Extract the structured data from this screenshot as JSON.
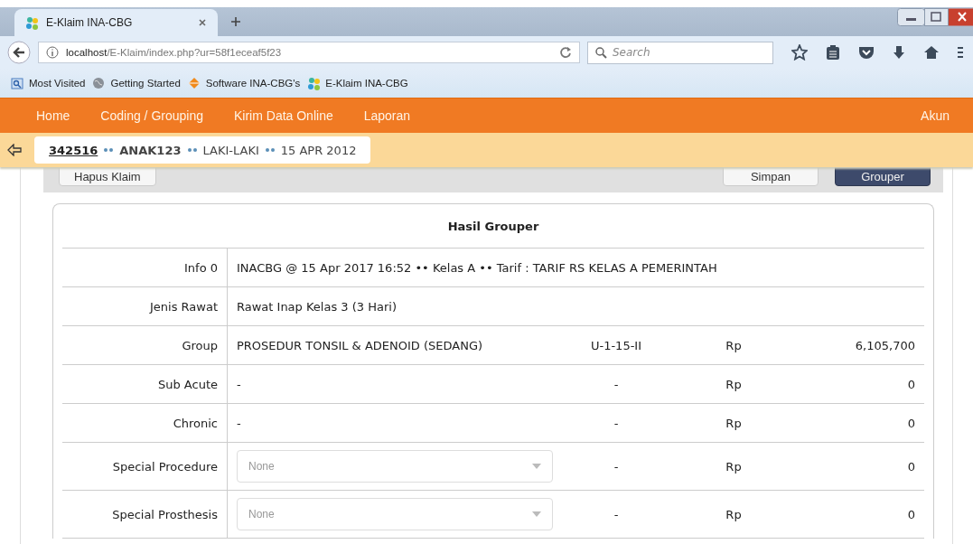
{
  "browser": {
    "tab": {
      "title": "E-Klaim INA-CBG",
      "selected": true
    },
    "url": {
      "host": "localhost",
      "path": "/E-Klaim/index.php?ur=58f1eceaf5f23"
    },
    "search": {
      "placeholder": "Search"
    },
    "bookmarks": [
      {
        "label": "Most Visited",
        "kind": "folder"
      },
      {
        "label": "Getting Started",
        "kind": "globe"
      },
      {
        "label": "Software INA-CBG's",
        "kind": "diamond"
      },
      {
        "label": "E-Klaim INA-CBG",
        "kind": "app"
      }
    ]
  },
  "nav": {
    "items": [
      "Home",
      "Coding / Grouping",
      "Kirim Data Online",
      "Laporan"
    ],
    "account": "Akun"
  },
  "patient": {
    "id": "342516",
    "name": "ANAK123",
    "sex": "LAKI-LAKI",
    "birth": "15 APR 2012"
  },
  "toolbar": {
    "left": [
      "Hapus Klaim"
    ],
    "right": [
      {
        "label": "Simpan",
        "primary": false
      },
      {
        "label": "Grouper",
        "primary": true
      }
    ]
  },
  "result": {
    "title": "Hasil Grouper",
    "rows": [
      {
        "label": "Info 0",
        "kind": "text",
        "value": "INACBG @ 15 Apr 2017 16:52 •• Kelas A •• Tarif : TARIF RS KELAS A PEMERINTAH"
      },
      {
        "label": "Jenis Rawat",
        "kind": "text",
        "value": "Rawat Inap Kelas 3 (3 Hari)"
      },
      {
        "label": "Group",
        "kind": "tariff",
        "value": "PROSEDUR TONSIL & ADENOID (SEDANG)",
        "code": "U-1-15-II",
        "currency": "Rp",
        "amount": "6,105,700"
      },
      {
        "label": "Sub Acute",
        "kind": "tariff",
        "value": "-",
        "code": "-",
        "currency": "Rp",
        "amount": "0"
      },
      {
        "label": "Chronic",
        "kind": "tariff",
        "value": "-",
        "code": "-",
        "currency": "Rp",
        "amount": "0"
      },
      {
        "label": "Special Procedure",
        "kind": "select",
        "disabled": true,
        "value": "None",
        "code": "-",
        "currency": "Rp",
        "amount": "0"
      },
      {
        "label": "Special Prosthesis",
        "kind": "select",
        "disabled": true,
        "value": "None",
        "code": "-",
        "currency": "Rp",
        "amount": "0"
      }
    ]
  }
}
